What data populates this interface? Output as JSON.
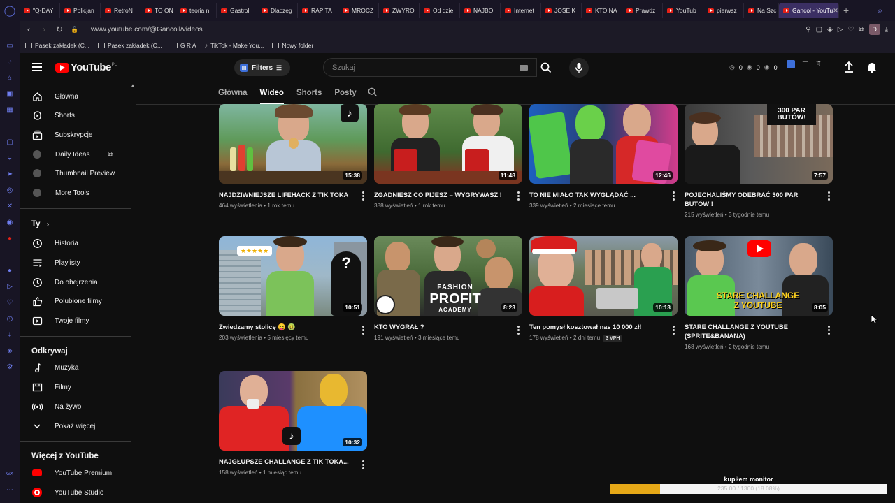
{
  "browser": {
    "tabs": [
      {
        "label": "\"Q-DAY"
      },
      {
        "label": "Policjan"
      },
      {
        "label": "RetroN"
      },
      {
        "label": "TO ON"
      },
      {
        "label": "teoria n"
      },
      {
        "label": "Gastrol"
      },
      {
        "label": "Dlaczeg"
      },
      {
        "label": "RAP TA"
      },
      {
        "label": "MROCZ"
      },
      {
        "label": "ZWYRO"
      },
      {
        "label": "Od dzie"
      },
      {
        "label": "NAJBO"
      },
      {
        "label": "Internet"
      },
      {
        "label": "JOSE K"
      },
      {
        "label": "KTO NA"
      },
      {
        "label": "Prawdz"
      },
      {
        "label": "YouTub"
      },
      {
        "label": "pierwsz"
      },
      {
        "label": "Na Szc"
      }
    ],
    "active_tab": "Gancol - YouTu",
    "url": "www.youtube.com/@Gancoll/videos",
    "profile_initial": "D",
    "bookmarks": [
      "Pasek zakładek (C...",
      "Pasek zakładek (C...",
      "G R A",
      "TikTok - Make You...",
      "Nowy folder"
    ]
  },
  "header": {
    "logo": "YouTube",
    "logo_region": "PL",
    "filters_label": "Filters",
    "search_placeholder": "Szukaj",
    "stats": [
      "0",
      "0",
      "0"
    ]
  },
  "sidebar": {
    "main": [
      {
        "label": "Główna",
        "icon": "home-icon"
      },
      {
        "label": "Shorts",
        "icon": "shorts-icon"
      },
      {
        "label": "Subskrypcje",
        "icon": "subscriptions-icon"
      }
    ],
    "extras": [
      {
        "label": "Daily Ideas"
      },
      {
        "label": "Thumbnail Preview"
      },
      {
        "label": "More Tools"
      }
    ],
    "you_heading": "Ty",
    "you": [
      {
        "label": "Historia",
        "icon": "history-icon"
      },
      {
        "label": "Playlisty",
        "icon": "playlist-icon"
      },
      {
        "label": "Do obejrzenia",
        "icon": "watch-later-icon"
      },
      {
        "label": "Polubione filmy",
        "icon": "like-icon"
      },
      {
        "label": "Twoje filmy",
        "icon": "your-videos-icon"
      }
    ],
    "explore_heading": "Odkrywaj",
    "explore": [
      {
        "label": "Muzyka",
        "icon": "music-icon"
      },
      {
        "label": "Filmy",
        "icon": "film-icon"
      },
      {
        "label": "Na żywo",
        "icon": "live-icon"
      },
      {
        "label": "Pokaż więcej",
        "icon": "chevron-down-icon"
      }
    ],
    "more_heading": "Więcej z YouTube",
    "more": [
      {
        "label": "YouTube Premium"
      },
      {
        "label": "YouTube Studio"
      }
    ]
  },
  "channel_tabs": [
    "Główna",
    "Wideo",
    "Shorts",
    "Posty"
  ],
  "active_channel_tab": "Wideo",
  "videos": [
    {
      "title": "NAJDZIWNIEJSZE LIFEHACK Z TIK TOKA",
      "views": "464 wyświetlenia",
      "age": "1 rok temu",
      "duration": "15:38"
    },
    {
      "title": "ZGADNIESZ CO PIJESZ = WYGRYWASZ !",
      "views": "388 wyświetleń",
      "age": "1 rok temu",
      "duration": "11:48"
    },
    {
      "title": "TO NIE MIAŁO TAK WYGLĄDAĆ ...",
      "views": "339 wyświetleń",
      "age": "2 miesiące temu",
      "duration": "12:46"
    },
    {
      "title": "POJECHALIŚMY ODEBRAĆ 300 PAR BUTÓW !",
      "views": "215 wyświetleń",
      "age": "3 tygodnie temu",
      "duration": "7:57"
    },
    {
      "title": "Zwiedzamy stolicę 😝 🤢",
      "views": "203 wyświetlenia",
      "age": "5 miesięcy temu",
      "duration": "10:51"
    },
    {
      "title": "KTO WYGRAŁ ?",
      "views": "191 wyświetleń",
      "age": "3 miesiące temu",
      "duration": "8:23"
    },
    {
      "title": "Ten pomysł kosztował nas 10 000 zł!",
      "views": "178 wyświetleń",
      "age": "2 dni temu",
      "duration": "10:13",
      "badge": "3 VPH"
    },
    {
      "title": "STARE CHALLANGE Z YOUTUBE (SPRITE&BANANA)",
      "views": "168 wyświetleń",
      "age": "2 tygodnie temu",
      "duration": "8:05"
    },
    {
      "title": "NAJGŁUPSZE CHALLANGE Z TIK TOKA...",
      "views": "158 wyświetleń",
      "age": "1 miesiąc temu",
      "duration": "10:32"
    }
  ],
  "thumb_text": {
    "shoes": "300 PAR BUTÓW!",
    "fashion": "FASHION",
    "profit": "PROFIT",
    "academy": "ACADEMY",
    "stare": "STARE CHALLANGE",
    "zyt": "Z YOUTUBE",
    "stars": "★★★★★"
  },
  "donation": {
    "title": "kupiłem monitor",
    "progress_text": "235.00 / 1300 (18.08%)",
    "progress": 0.1808
  }
}
